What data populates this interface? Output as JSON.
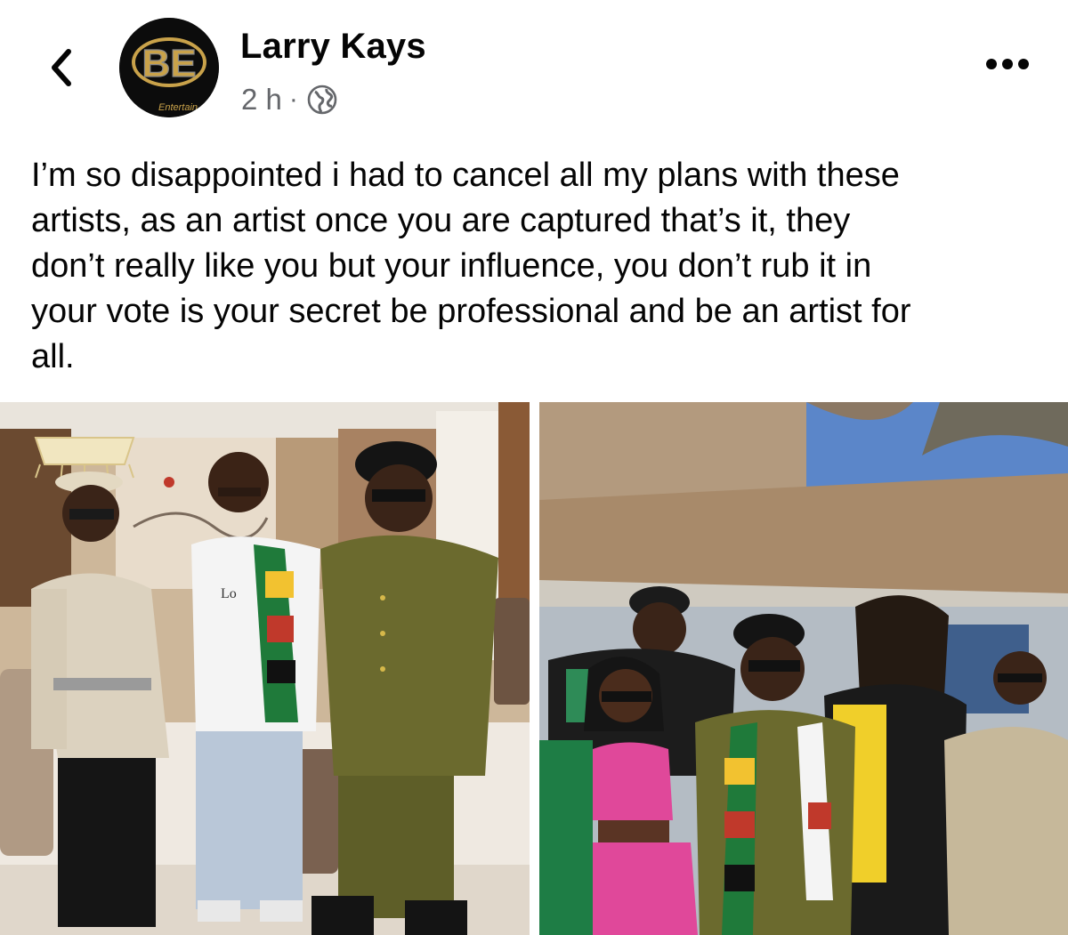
{
  "header": {
    "author_name": "Larry Kays",
    "timestamp": "2 h",
    "separator": "·",
    "audience_icon": "globe-icon",
    "avatar_logo_text": "BE",
    "avatar_caption": "Entertain"
  },
  "post": {
    "lines": [
      "I’m so disappointed i had to cancel all my plans with these",
      "artists, as an artist once you are captured that’s it, they",
      "don’t really like you but your influence, you don’t rub it in",
      "your vote is your secret be professional and be an artist for",
      "all."
    ]
  },
  "photos": {
    "count": 2,
    "left_shirt_text": "Lo"
  },
  "icons": {
    "back": "chevron-left-icon",
    "more": "more-horizontal-icon"
  },
  "colors": {
    "text_primary": "#050505",
    "text_secondary": "#65676b",
    "avatar_gold": "#c9a24a"
  }
}
